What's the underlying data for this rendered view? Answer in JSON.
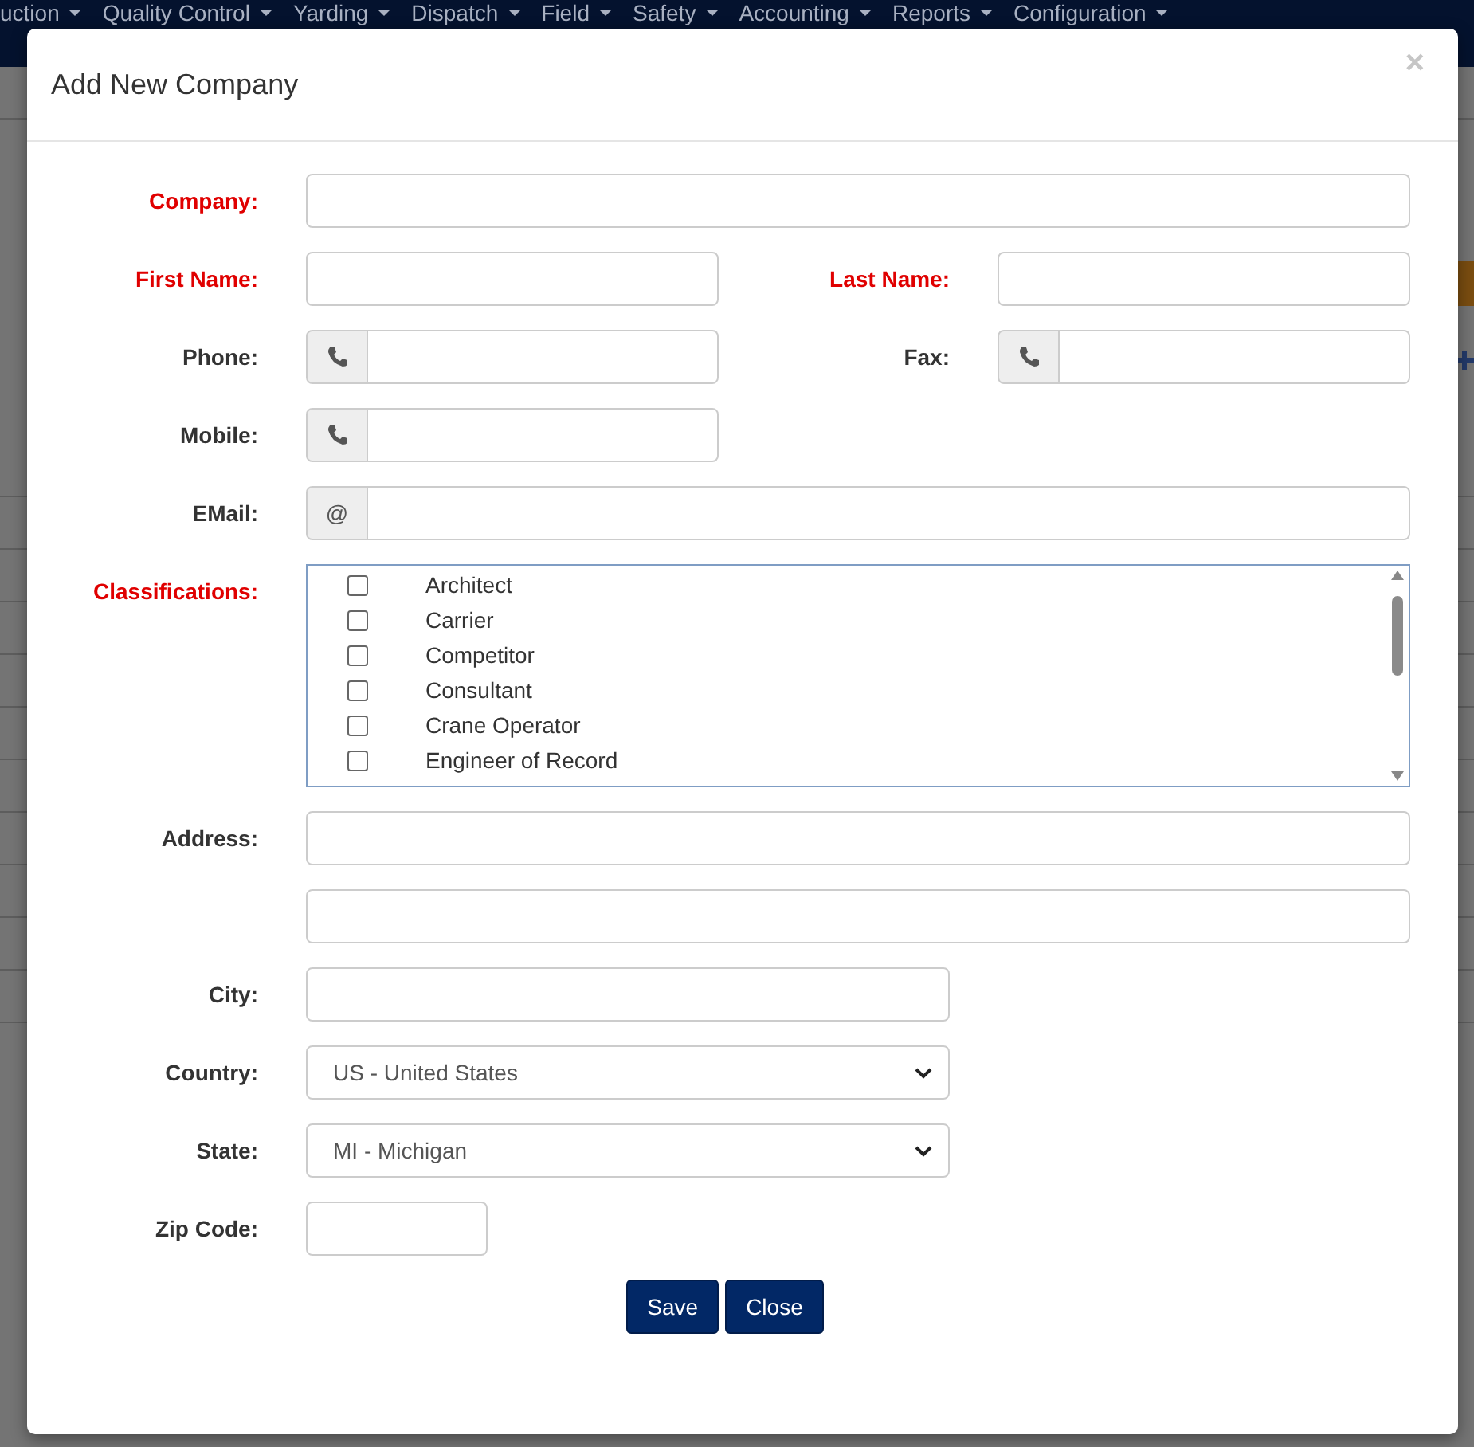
{
  "nav": {
    "items": [
      {
        "label": "uction"
      },
      {
        "label": "Quality Control"
      },
      {
        "label": "Yarding"
      },
      {
        "label": "Dispatch"
      },
      {
        "label": "Field"
      },
      {
        "label": "Safety"
      },
      {
        "label": "Accounting"
      },
      {
        "label": "Reports"
      },
      {
        "label": "Configuration"
      }
    ]
  },
  "modal": {
    "title": "Add New Company",
    "close_symbol": "×",
    "rows": [
      {
        "fields": [
          {
            "label": "Company:",
            "required": true,
            "kind": "text"
          }
        ]
      },
      {
        "fields": [
          {
            "label": "First Name:",
            "required": true,
            "kind": "text"
          },
          {
            "label": "Last Name:",
            "required": true,
            "kind": "text"
          }
        ]
      },
      {
        "fields": [
          {
            "label": "Phone:",
            "required": false,
            "kind": "phone"
          },
          {
            "label": "Fax:",
            "required": false,
            "kind": "phone"
          }
        ]
      },
      {
        "fields": [
          {
            "label": "Mobile:",
            "required": false,
            "kind": "phone"
          }
        ]
      },
      {
        "fields": [
          {
            "label": "EMail:",
            "required": false,
            "kind": "email",
            "addon": "@"
          }
        ]
      },
      {
        "fields": [
          {
            "label": "Classifications:",
            "required": true,
            "kind": "checklist",
            "options": [
              {
                "label": "Architect",
                "checked": false
              },
              {
                "label": "Carrier",
                "checked": false
              },
              {
                "label": "Competitor",
                "checked": false
              },
              {
                "label": "Consultant",
                "checked": false
              },
              {
                "label": "Crane Operator",
                "checked": false
              },
              {
                "label": "Engineer of Record",
                "checked": false
              }
            ]
          }
        ]
      },
      {
        "fields": [
          {
            "label": "Address:",
            "required": false,
            "kind": "text"
          }
        ]
      },
      {
        "fields": [
          {
            "kind": "text"
          }
        ]
      },
      {
        "fields": [
          {
            "label": "City:",
            "required": false,
            "kind": "text-medium"
          }
        ]
      },
      {
        "fields": [
          {
            "label": "Country:",
            "required": false,
            "kind": "select",
            "value": "US - United States"
          }
        ]
      },
      {
        "fields": [
          {
            "label": "State:",
            "required": false,
            "kind": "select",
            "value": "MI - Michigan"
          }
        ]
      },
      {
        "fields": [
          {
            "label": "Zip Code:",
            "required": false,
            "kind": "text-small"
          }
        ]
      }
    ],
    "buttons": [
      {
        "label": "Save"
      },
      {
        "label": "Close"
      }
    ]
  }
}
